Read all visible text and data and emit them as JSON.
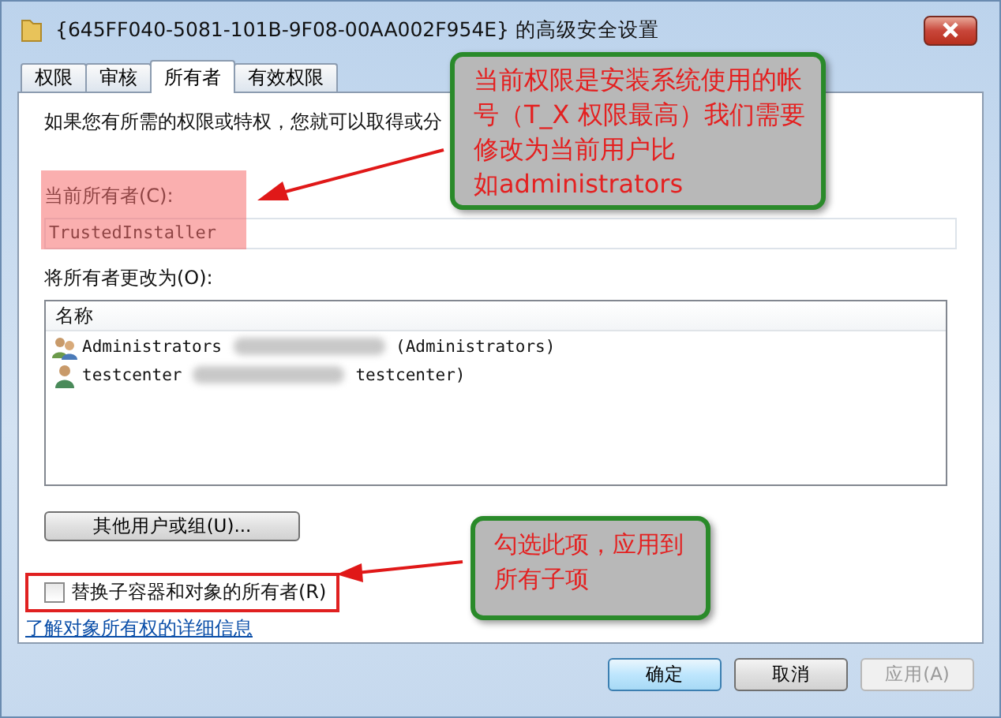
{
  "window": {
    "title": "{645FF040-5081-101B-9F08-00AA002F954E} 的高级安全设置"
  },
  "tabs": [
    {
      "label": "权限",
      "selected": false
    },
    {
      "label": "审核",
      "selected": false
    },
    {
      "label": "所有者",
      "selected": true
    },
    {
      "label": "有效权限",
      "selected": false
    }
  ],
  "intro": "如果您有所需的权限或特权，您就可以取得或分",
  "current_owner": {
    "label": "当前所有者(C):",
    "value": "TrustedInstaller",
    "highlighted": true
  },
  "change_owner": {
    "label": "将所有者更改为(O):",
    "column": "名称",
    "rows": [
      {
        "kind": "group",
        "name": "Administrators",
        "account": "(Administrators)"
      },
      {
        "kind": "user",
        "name": "testcenter",
        "account": "testcenter)"
      }
    ]
  },
  "other_users_button": "其他用户或组(U)...",
  "replace_checkbox": {
    "label": "替换子容器和对象的所有者(R)",
    "checked": false
  },
  "link": "了解对象所有权的详细信息",
  "buttons": [
    {
      "label": "确定",
      "disabled": false,
      "default": true
    },
    {
      "label": "取消",
      "disabled": false,
      "default": false
    },
    {
      "label": "应用(A)",
      "disabled": true,
      "default": false
    }
  ],
  "annotations": [
    {
      "lines": [
        "当前权限是安装系统使用的帐",
        "号（T_X 权限最高）我们需要",
        "修改为当前用户比",
        "如administrators"
      ]
    },
    {
      "lines": [
        "勾选此项，应用到",
        "所有子项"
      ]
    }
  ]
}
